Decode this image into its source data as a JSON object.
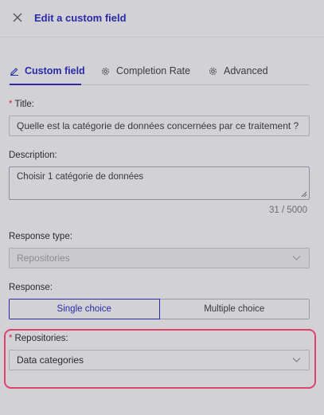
{
  "header": {
    "title": "Edit a custom field",
    "close_icon": "close-icon"
  },
  "tabs": [
    {
      "label": "Custom field",
      "icon": "edit-icon",
      "active": true
    },
    {
      "label": "Completion Rate",
      "icon": "gear-icon",
      "active": false
    },
    {
      "label": "Advanced",
      "icon": "gear-icon",
      "active": false
    }
  ],
  "form": {
    "title_label": "Title",
    "title_value": "Quelle est la catégorie de données concernées par ce traitement ?",
    "description_label": "Description",
    "description_value": "Choisir 1 catégorie de données",
    "char_counter": "31 / 5000",
    "response_type_label": "Response type",
    "response_type_value": "Repositories",
    "response_label": "Response",
    "response_options": [
      "Single choice",
      "Multiple choice"
    ],
    "response_selected": "Single choice",
    "repositories_label": "Repositories",
    "repositories_value": "Data categories",
    "required_mark": "*",
    "colon": ":"
  },
  "colors": {
    "accent": "#2a2aa8",
    "required": "#d8283d",
    "highlight": "#e0426e",
    "background": "#d1d1d6"
  }
}
